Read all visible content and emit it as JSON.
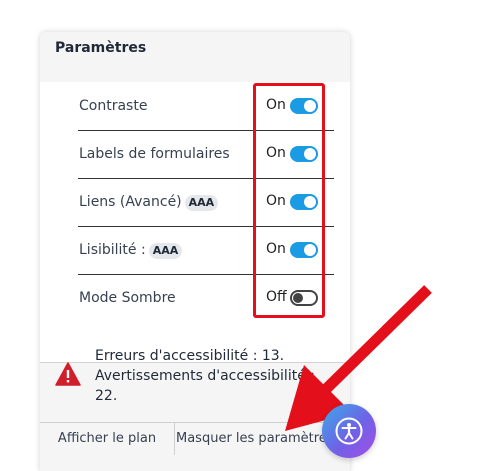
{
  "panel": {
    "title": "Paramètres"
  },
  "settings": [
    {
      "label": "Contraste",
      "badge": "",
      "state": "On"
    },
    {
      "label": "Labels de formulaires",
      "badge": "",
      "state": "On"
    },
    {
      "label": "Liens (Avancé)",
      "badge": "AAA",
      "state": "On"
    },
    {
      "label": "Lisibilité :",
      "badge": "AAA",
      "state": "On"
    },
    {
      "label": "Mode Sombre",
      "badge": "",
      "state": "Off"
    }
  ],
  "results": {
    "errors": "Erreurs d'accessibilité : 13.",
    "warnings_line1": "Avertissements d'accessibilité :",
    "warnings_line2": "22."
  },
  "footer": {
    "show_plan": "Afficher le plan",
    "hide_settings": "Masquer les paramètres"
  },
  "colors": {
    "toggle_on": "#1a9be3",
    "highlight": "#e3101c",
    "warning": "#d01e2a"
  },
  "icons": {
    "warning": "warning-triangle-icon",
    "fab": "accessibility-person-icon"
  }
}
